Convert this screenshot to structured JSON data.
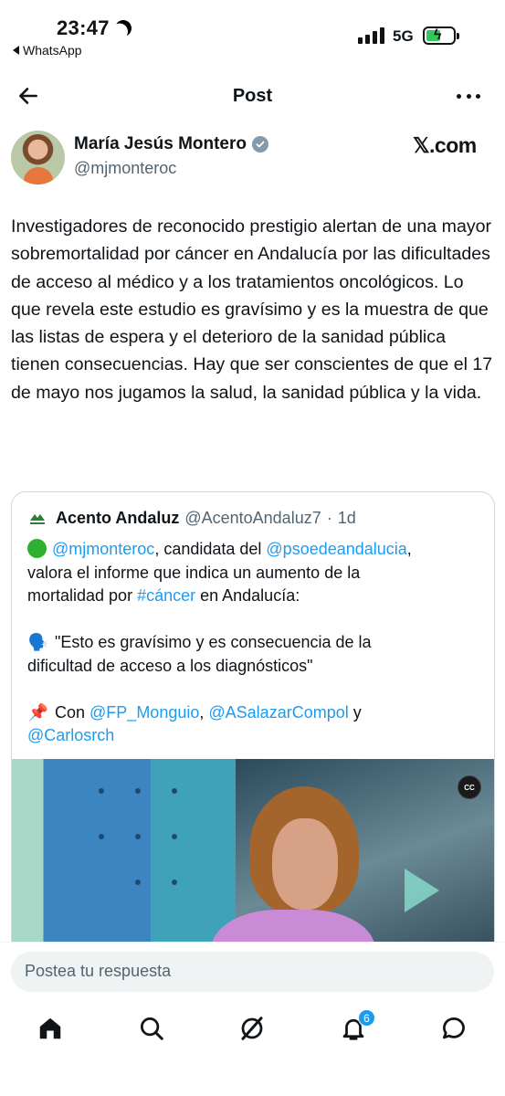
{
  "status_bar": {
    "time": "23:47",
    "back_app": "WhatsApp",
    "network": "5G"
  },
  "nav": {
    "title": "Post"
  },
  "author": {
    "name": "María Jesús Montero",
    "handle": "@mjmonteroc",
    "brand": "𝕏.com"
  },
  "post": {
    "text": "Investigadores de reconocido prestigio alertan de una mayor sobremortalidad por cáncer en Andalucía por las dificultades de acceso al médico y a los tratamientos oncológicos. Lo que revela este estudio es gravísimo y es la muestra de que las listas de espera y el deterioro de la sanidad pública tienen consecuencias. Hay que ser conscientes de que el 17 de mayo nos jugamos la salud, la sanidad pública y la vida."
  },
  "quote": {
    "name": "Acento Andaluz",
    "handle": "@AcentoAndaluz7",
    "separator": "·",
    "time": "1d",
    "line1_mention": "@mjmonteroc",
    "line1_text": ", candidata del ",
    "line1_mention2": "@psoedeandalucia",
    "line1_end": ",",
    "line2": "valora el informe que indica un aumento de la",
    "line3_pre": "mortalidad por ",
    "line3_hashtag": "#cáncer",
    "line3_post": " en Andalucía:",
    "quote_emoji": "🗣️",
    "line5": "\"Esto es gravísimo y es consecuencia de la",
    "line6": "dificultad de acceso a los diagnósticos\"",
    "pin_emoji": "📌",
    "line8_pre": "Con ",
    "line8_mention1": "@FP_Monguio",
    "line8_sep": ", ",
    "line8_mention2": "@ASalazarCompol",
    "line8_post": " y",
    "line9_mention": "@Carlosrch",
    "cc_label": "CC"
  },
  "reply": {
    "placeholder": "Postea tu respuesta"
  },
  "tabbar": {
    "notifications_count": "6"
  },
  "colors": {
    "link": "#1d9bf0",
    "text": "#0f1419",
    "secondary": "#536471",
    "reply_bg": "#eff3f4"
  }
}
